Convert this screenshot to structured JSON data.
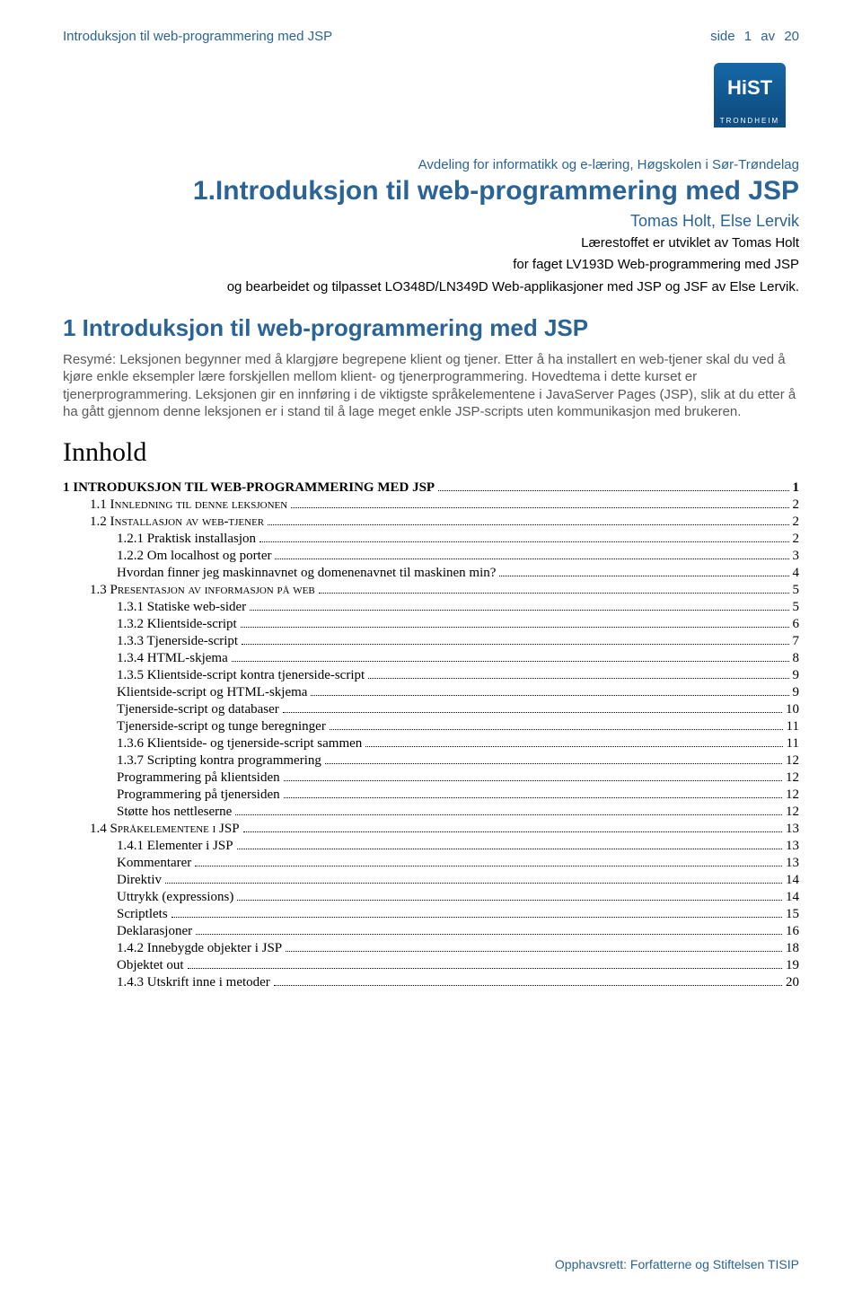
{
  "header": {
    "left": "Introduksjon til web-programmering med JSP",
    "side": "side",
    "page": "1",
    "av": "av",
    "total": "20"
  },
  "logo": {
    "main": "HiST",
    "sub": "TRONDHEIM"
  },
  "byline": "Avdeling for informatikk og e-læring, Høgskolen i Sør-Trøndelag",
  "title": "1.Introduksjon til web-programmering med JSP",
  "authors": "Tomas Holt, Else Lervik",
  "attrib1": "Lærestoffet er utviklet av Tomas Holt",
  "attrib2": "for faget LV193D Web-programmering med JSP",
  "attrib3": "og bearbeidet og tilpasset LO348D/LN349D Web-applikasjoner med JSP og JSF av Else Lervik.",
  "section_head": "1  Introduksjon til web-programmering med JSP",
  "resume": "Resymé: Leksjonen begynner med å klargjøre begrepene klient og tjener. Etter å ha installert en web-tjener skal du ved å kjøre enkle eksempler lære forskjellen mellom klient- og tjenerprogrammering. Hovedtema i dette kurset er tjenerprogrammering. Leksjonen gir en innføring i de viktigste språkelementene i JavaServer Pages (JSP), slik at du etter å ha gått gjennom denne leksjonen er i stand til å lage meget enkle JSP-scripts uten kommunikasjon med brukeren.",
  "innhold": "Innhold",
  "toc": [
    {
      "label": "1      INTRODUKSJON TIL WEB-PROGRAMMERING MED JSP",
      "page": "1",
      "ind": 0,
      "bold": true
    },
    {
      "label": "1.1     Innledning til denne leksjonen",
      "page": "2",
      "ind": 1,
      "sc": true
    },
    {
      "label": "1.2     Installasjon av web-tjener",
      "page": "2",
      "ind": 1,
      "sc": true
    },
    {
      "label": "1.2.1    Praktisk installasjon",
      "page": "2",
      "ind": 2
    },
    {
      "label": "1.2.2    Om localhost og porter",
      "page": "3",
      "ind": 2
    },
    {
      "label": "Hvordan finner jeg maskinnavnet og domenenavnet til maskinen min?",
      "page": "4",
      "ind": 3
    },
    {
      "label": "1.3     Presentasjon av informasjon på web",
      "page": "5",
      "ind": 1,
      "sc": true
    },
    {
      "label": "1.3.1    Statiske web-sider",
      "page": "5",
      "ind": 2
    },
    {
      "label": "1.3.2    Klientside-script",
      "page": "6",
      "ind": 2
    },
    {
      "label": "1.3.3    Tjenerside-script",
      "page": "7",
      "ind": 2
    },
    {
      "label": "1.3.4    HTML-skjema",
      "page": "8",
      "ind": 2
    },
    {
      "label": "1.3.5    Klientside-script kontra tjenerside-script",
      "page": "9",
      "ind": 2
    },
    {
      "label": "Klientside-script og HTML-skjema",
      "page": "9",
      "ind": 3
    },
    {
      "label": "Tjenerside-script og databaser",
      "page": "10",
      "ind": 3
    },
    {
      "label": "Tjenerside-script og tunge beregninger",
      "page": "11",
      "ind": 3
    },
    {
      "label": "1.3.6    Klientside- og tjenerside-script sammen",
      "page": "11",
      "ind": 2
    },
    {
      "label": "1.3.7    Scripting kontra programmering",
      "page": "12",
      "ind": 2
    },
    {
      "label": "Programmering på klientsiden",
      "page": "12",
      "ind": 3
    },
    {
      "label": "Programmering på tjenersiden",
      "page": "12",
      "ind": 3
    },
    {
      "label": "Støtte hos nettleserne",
      "page": "12",
      "ind": 3
    },
    {
      "label": "1.4     Språkelementene i JSP",
      "page": "13",
      "ind": 1,
      "sc": true
    },
    {
      "label": "1.4.1    Elementer i JSP",
      "page": "13",
      "ind": 2
    },
    {
      "label": "Kommentarer",
      "page": "13",
      "ind": 3
    },
    {
      "label": "Direktiv",
      "page": "14",
      "ind": 3
    },
    {
      "label": "Uttrykk (expressions)",
      "page": "14",
      "ind": 3
    },
    {
      "label": "Scriptlets",
      "page": "15",
      "ind": 3
    },
    {
      "label": "Deklarasjoner",
      "page": "16",
      "ind": 3
    },
    {
      "label": "1.4.2    Innebygde objekter i JSP",
      "page": "18",
      "ind": 2
    },
    {
      "label": "Objektet out",
      "page": "19",
      "ind": 3
    },
    {
      "label": "1.4.3    Utskrift inne i metoder",
      "page": "20",
      "ind": 2
    }
  ],
  "footer": "Opphavsrett: Forfatterne og Stiftelsen TISIP"
}
